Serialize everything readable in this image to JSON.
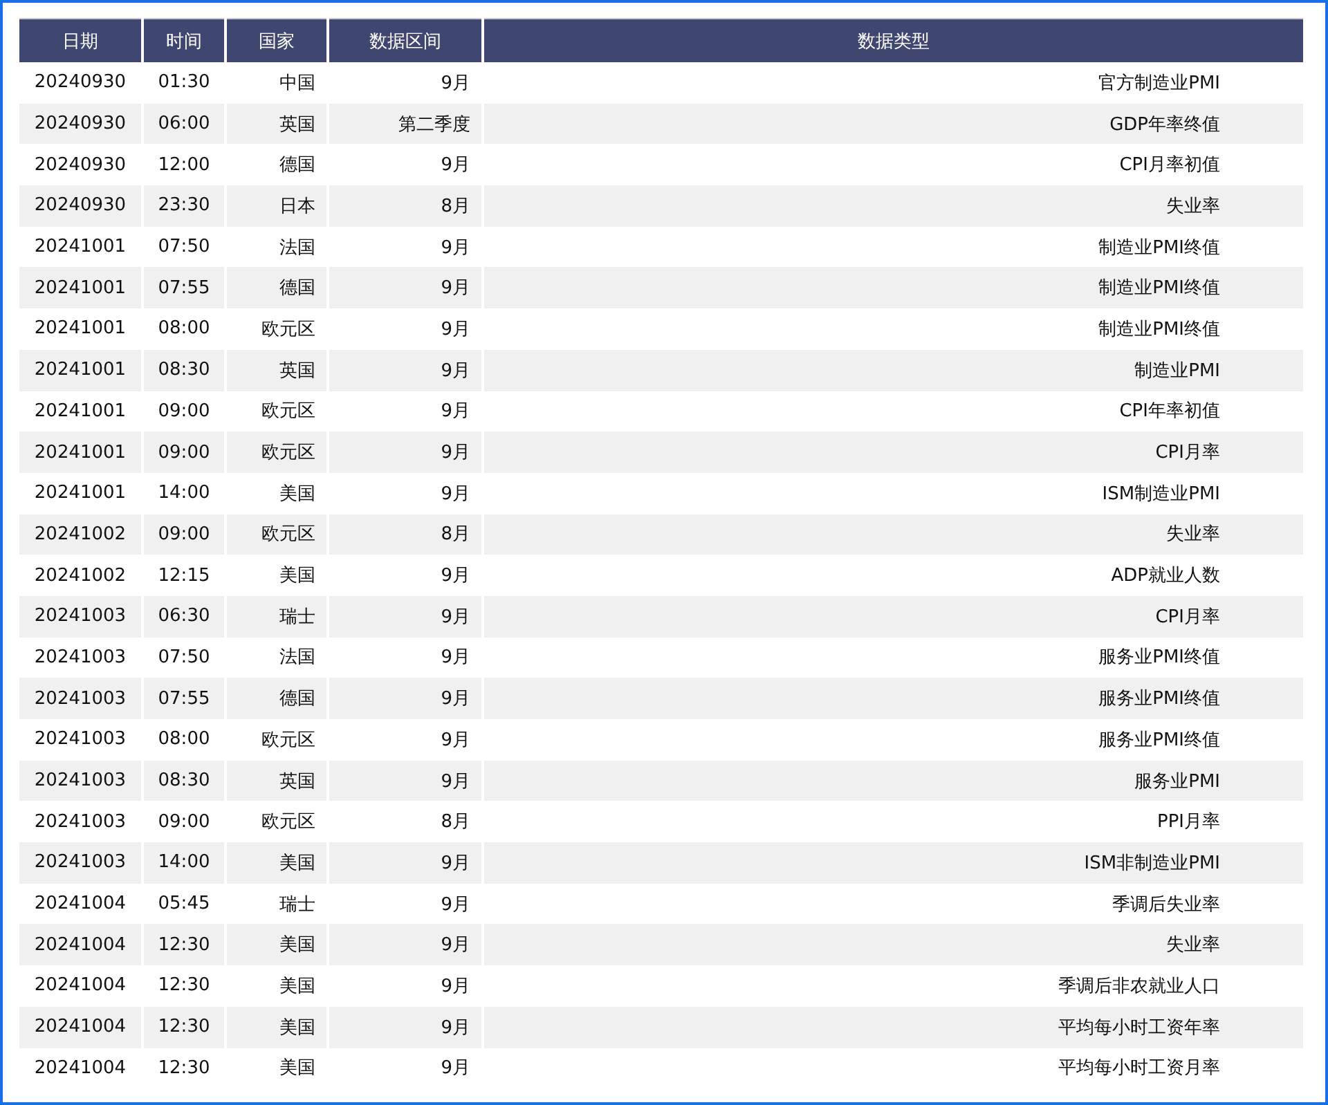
{
  "table": {
    "columns": [
      "日期",
      "时间",
      "国家",
      "数据区间",
      "数据类型"
    ],
    "rows": [
      [
        "20240930",
        "01:30",
        "中国",
        "9月",
        "官方制造业PMI"
      ],
      [
        "20240930",
        "06:00",
        "英国",
        "第二季度",
        "GDP年率终值"
      ],
      [
        "20240930",
        "12:00",
        "德国",
        "9月",
        "CPI月率初值"
      ],
      [
        "20240930",
        "23:30",
        "日本",
        "8月",
        "失业率"
      ],
      [
        "20241001",
        "07:50",
        "法国",
        "9月",
        "制造业PMI终值"
      ],
      [
        "20241001",
        "07:55",
        "德国",
        "9月",
        "制造业PMI终值"
      ],
      [
        "20241001",
        "08:00",
        "欧元区",
        "9月",
        "制造业PMI终值"
      ],
      [
        "20241001",
        "08:30",
        "英国",
        "9月",
        "制造业PMI"
      ],
      [
        "20241001",
        "09:00",
        "欧元区",
        "9月",
        "CPI年率初值"
      ],
      [
        "20241001",
        "09:00",
        "欧元区",
        "9月",
        "CPI月率"
      ],
      [
        "20241001",
        "14:00",
        "美国",
        "9月",
        "ISM制造业PMI"
      ],
      [
        "20241002",
        "09:00",
        "欧元区",
        "8月",
        "失业率"
      ],
      [
        "20241002",
        "12:15",
        "美国",
        "9月",
        "ADP就业人数"
      ],
      [
        "20241003",
        "06:30",
        "瑞士",
        "9月",
        "CPI月率"
      ],
      [
        "20241003",
        "07:50",
        "法国",
        "9月",
        "服务业PMI终值"
      ],
      [
        "20241003",
        "07:55",
        "德国",
        "9月",
        "服务业PMI终值"
      ],
      [
        "20241003",
        "08:00",
        "欧元区",
        "9月",
        "服务业PMI终值"
      ],
      [
        "20241003",
        "08:30",
        "英国",
        "9月",
        "服务业PMI"
      ],
      [
        "20241003",
        "09:00",
        "欧元区",
        "8月",
        "PPI月率"
      ],
      [
        "20241003",
        "14:00",
        "美国",
        "9月",
        "ISM非制造业PMI"
      ],
      [
        "20241004",
        "05:45",
        "瑞士",
        "9月",
        "季调后失业率"
      ],
      [
        "20241004",
        "12:30",
        "美国",
        "9月",
        "失业率"
      ],
      [
        "20241004",
        "12:30",
        "美国",
        "9月",
        "季调后非农就业人口"
      ],
      [
        "20241004",
        "12:30",
        "美国",
        "9月",
        "平均每小时工资年率"
      ],
      [
        "20241004",
        "12:30",
        "美国",
        "9月",
        "平均每小时工资月率"
      ]
    ]
  }
}
